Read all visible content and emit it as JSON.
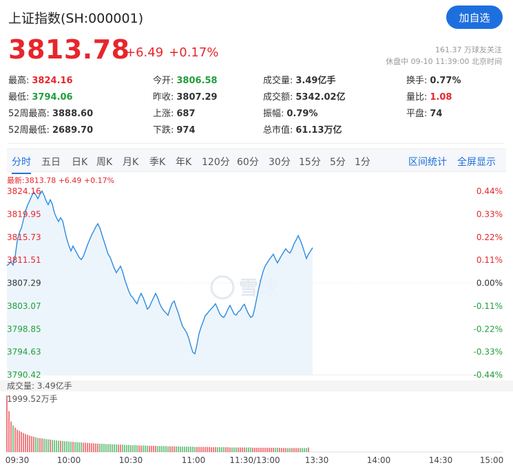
{
  "header": {
    "title": "上证指数(SH:000001)",
    "follow_label": "加自选",
    "price": "3813.78",
    "change": "+6.49",
    "change_pct": "+0.17%",
    "followers": "161.37 万球友关注",
    "status": "休盘中 09-10 11:39:00 北京时间"
  },
  "quote": [
    {
      "label": "最高:",
      "value": "3824.16",
      "tone": "red"
    },
    {
      "label": "今开:",
      "value": "3806.58",
      "tone": "green"
    },
    {
      "label": "成交量:",
      "value": "3.49亿手",
      "tone": ""
    },
    {
      "label": "换手:",
      "value": "0.77%",
      "tone": ""
    },
    {
      "label": "最低:",
      "value": "3794.06",
      "tone": "green"
    },
    {
      "label": "昨收:",
      "value": "3807.29",
      "tone": ""
    },
    {
      "label": "成交额:",
      "value": "5342.02亿",
      "tone": ""
    },
    {
      "label": "量比:",
      "value": "1.08",
      "tone": "red"
    },
    {
      "label": "52周最高:",
      "value": "3888.60",
      "tone": ""
    },
    {
      "label": "上涨:",
      "value": "687",
      "tone": ""
    },
    {
      "label": "振幅:",
      "value": "0.79%",
      "tone": ""
    },
    {
      "label": "平盘:",
      "value": "74",
      "tone": ""
    },
    {
      "label": "52周最低:",
      "value": "2689.70",
      "tone": ""
    },
    {
      "label": "下跌:",
      "value": "974",
      "tone": ""
    },
    {
      "label": "总市值:",
      "value": "61.13万亿",
      "tone": ""
    }
  ],
  "tabs": [
    "分时",
    "五日",
    "日K",
    "周K",
    "月K",
    "季K",
    "年K",
    "120分",
    "60分",
    "30分",
    "15分",
    "5分",
    "1分"
  ],
  "tabs_right": [
    "区间统计",
    "全屏显示"
  ],
  "latest_text": "最新:3813.78 +6.49 +0.17%",
  "volume_label": "成交量: 3.49亿手",
  "volume_max_label": "1999.52万手",
  "watermark": "雪球",
  "colors": {
    "up": "#e6262c",
    "down": "#1f9e3b",
    "line": "#2a8ae0",
    "accent": "#1e6fde"
  },
  "chart_data": {
    "type": "line",
    "y_labels": [
      "3824.16",
      "3819.95",
      "3815.73",
      "3811.51",
      "3807.29",
      "3803.07",
      "3798.85",
      "3794.63",
      "3790.42"
    ],
    "pct_labels": [
      "0.44%",
      "0.33%",
      "0.22%",
      "0.11%",
      "0.00%",
      "-0.11%",
      "-0.22%",
      "-0.33%",
      "-0.44%"
    ],
    "ylim": [
      3790.42,
      3824.16
    ],
    "prev_close": 3807.29,
    "x_labels": [
      "09:30",
      "10:00",
      "10:30",
      "11:00",
      "11:30/13:00",
      "13:30",
      "14:00",
      "14:30",
      "15:00"
    ],
    "total_minutes": 240,
    "series": [
      {
        "values": [
          3810.5,
          3810.8,
          3811.2,
          3810.6,
          3812.2,
          3815.0,
          3816.5,
          3817.4,
          3818.9,
          3820.5,
          3821.6,
          3822.4,
          3823.3,
          3824.0,
          3823.5,
          3822.8,
          3823.6,
          3824.2,
          3823.4,
          3822.4,
          3821.7,
          3822.6,
          3821.8,
          3820.2,
          3819.3,
          3818.6,
          3819.3,
          3818.7,
          3817.0,
          3815.4,
          3814.2,
          3813.2,
          3814.1,
          3813.4,
          3812.7,
          3812.0,
          3811.6,
          3812.2,
          3813.2,
          3814.3,
          3815.2,
          3816.1,
          3816.8,
          3817.6,
          3818.2,
          3817.4,
          3816.2,
          3815.0,
          3813.8,
          3812.6,
          3812.0,
          3811.0,
          3810.0,
          3809.2,
          3809.8,
          3810.4,
          3809.4,
          3808.0,
          3806.9,
          3805.8,
          3805.0,
          3804.6,
          3804.0,
          3803.5,
          3804.6,
          3805.4,
          3804.6,
          3803.6,
          3802.5,
          3802.9,
          3803.8,
          3804.6,
          3805.4,
          3804.6,
          3803.5,
          3802.7,
          3802.2,
          3801.8,
          3801.4,
          3802.6,
          3803.6,
          3804.0,
          3802.8,
          3801.8,
          3800.5,
          3799.4,
          3798.8,
          3798.2,
          3797.2,
          3795.8,
          3794.6,
          3794.3,
          3796.0,
          3798.0,
          3799.2,
          3800.2,
          3801.3,
          3801.7,
          3802.2,
          3802.6,
          3803.0,
          3803.5,
          3802.6,
          3801.7,
          3801.2,
          3801.0,
          3801.6,
          3802.5,
          3803.2,
          3802.4,
          3801.6,
          3801.4,
          3802.0,
          3802.3,
          3803.0,
          3803.4,
          3802.4,
          3801.6,
          3801.0,
          3801.2,
          3802.7,
          3804.6,
          3806.4,
          3808.0,
          3809.4,
          3810.4,
          3811.0,
          3811.6,
          3812.1,
          3812.6,
          3811.7,
          3811.0,
          3811.7,
          3812.4,
          3813.0,
          3813.6,
          3813.1,
          3812.8,
          3813.5,
          3814.5,
          3815.2,
          3816.0,
          3815.2,
          3814.2,
          3813.0,
          3811.8,
          3812.6,
          3813.2,
          3813.8
        ],
        "volumes": [
          19.99,
          14.5,
          10.8,
          9.4,
          8.6,
          7.9,
          7.5,
          7.1,
          6.7,
          6.4,
          6.1,
          5.8,
          5.6,
          5.4,
          5.2,
          5.0,
          4.9,
          4.8,
          4.7,
          4.6,
          4.5,
          4.4,
          4.3,
          4.2,
          4.1,
          4.0,
          4.0,
          3.9,
          3.8,
          3.8,
          3.7,
          3.6,
          3.6,
          3.5,
          3.5,
          3.4,
          3.4,
          3.3,
          3.3,
          3.2,
          3.2,
          3.1,
          3.1,
          3.0,
          3.0,
          2.9,
          2.9,
          2.9,
          2.8,
          2.8,
          2.8,
          2.7,
          2.7,
          2.7,
          2.6,
          2.6,
          2.6,
          2.5,
          2.5,
          2.5,
          2.4,
          2.4,
          2.4,
          2.4,
          2.3,
          2.3,
          2.3,
          2.3,
          2.2,
          2.2,
          2.2,
          2.2,
          2.2,
          2.1,
          2.1,
          2.1,
          2.1,
          2.1,
          2.0,
          2.0,
          2.0,
          2.0,
          2.0,
          2.0,
          1.9,
          1.9,
          1.9,
          1.9,
          1.9,
          1.9,
          1.9,
          1.8,
          1.8,
          1.8,
          1.8,
          1.8,
          1.8,
          1.8,
          1.8,
          1.7,
          1.7,
          1.7,
          1.7,
          1.7,
          1.7,
          1.7,
          1.7,
          1.7,
          1.6,
          1.6,
          1.6,
          1.6,
          1.6,
          1.6,
          1.6,
          1.6,
          1.6,
          1.6,
          1.6,
          1.5,
          1.5,
          1.5,
          1.5,
          1.5,
          1.5,
          1.5,
          1.5,
          1.5,
          1.5,
          1.5,
          1.5,
          1.5,
          1.5,
          1.4,
          1.4,
          1.4,
          1.4,
          1.4,
          1.4,
          1.4,
          1.4,
          1.4,
          1.4,
          1.4,
          1.4,
          1.4,
          1.6
        ]
      }
    ]
  }
}
